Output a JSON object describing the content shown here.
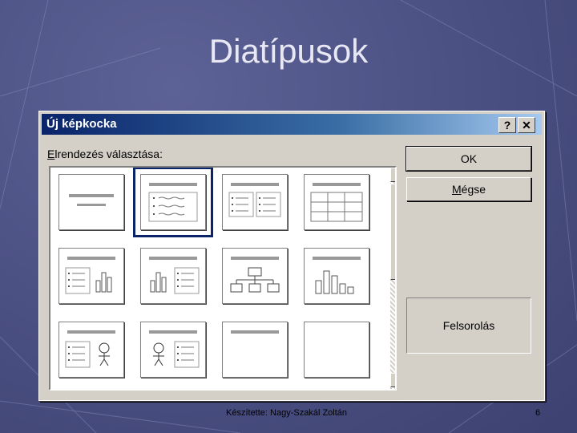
{
  "slide": {
    "title": "Diatípusok",
    "footer_author": "Készítette: Nagy-Szakál Zoltán",
    "page_number": "6"
  },
  "dialog": {
    "title": "Új képkocka",
    "help_label": "?",
    "close_label": "✕",
    "layout_label_prefix": "E",
    "layout_label_rest": "lrendezés választása:",
    "ok_label": "OK",
    "cancel_label_prefix": "M",
    "cancel_label_rest": "égse",
    "selected_description": "Felsorolás",
    "layouts": [
      {
        "id": "title",
        "selected": false
      },
      {
        "id": "bulleted-list",
        "selected": true
      },
      {
        "id": "two-column-text",
        "selected": false
      },
      {
        "id": "table",
        "selected": false
      },
      {
        "id": "text-and-chart",
        "selected": false
      },
      {
        "id": "chart-and-text",
        "selected": false
      },
      {
        "id": "organization-chart",
        "selected": false
      },
      {
        "id": "chart",
        "selected": false
      },
      {
        "id": "text-and-clip-art",
        "selected": false
      },
      {
        "id": "clip-art-and-text",
        "selected": false
      },
      {
        "id": "title-only",
        "selected": false
      },
      {
        "id": "blank",
        "selected": false
      }
    ]
  },
  "icons": {
    "scroll_up": "scroll-up-arrow-icon",
    "scroll_down": "scroll-down-arrow-icon",
    "help": "question-mark-icon",
    "close": "close-icon"
  },
  "colors": {
    "background": "#4a4f82",
    "titlebar_start": "#0a246a",
    "titlebar_end": "#a6caf0",
    "selection_outline": "#0a246a"
  }
}
